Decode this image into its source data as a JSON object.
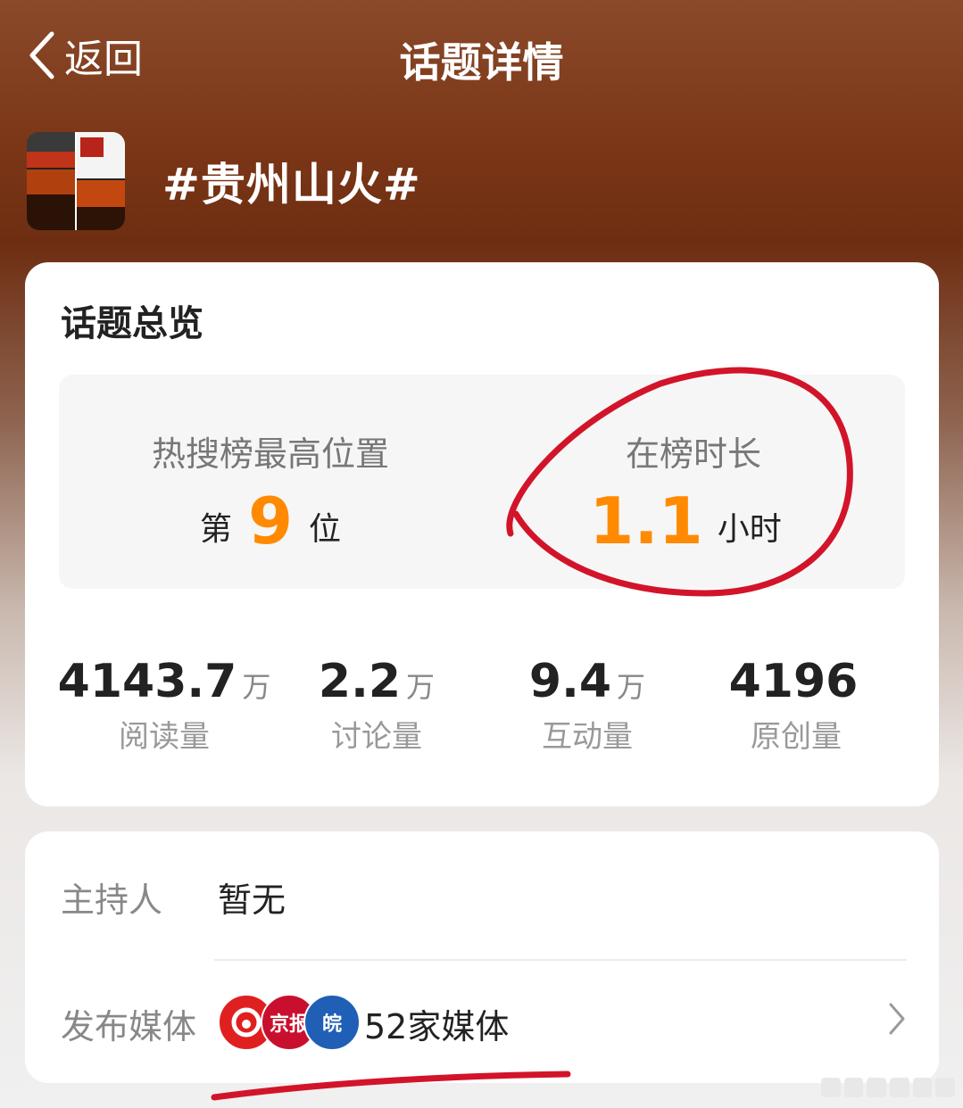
{
  "nav": {
    "back_label": "返回",
    "title": "话题详情"
  },
  "topic": {
    "title": "#贵州山火#"
  },
  "overview": {
    "title": "话题总览",
    "highest_rank": {
      "label": "热搜榜最高位置",
      "prefix": "第",
      "value": "9",
      "suffix": "位"
    },
    "duration": {
      "label": "在榜时长",
      "value": "1.1",
      "unit": "小时"
    },
    "stats": [
      {
        "value": "4143.7",
        "unit": "万",
        "label": "阅读量"
      },
      {
        "value": "2.2",
        "unit": "万",
        "label": "讨论量"
      },
      {
        "value": "9.4",
        "unit": "万",
        "label": "互动量"
      },
      {
        "value": "4196",
        "unit": "",
        "label": "原创量"
      }
    ]
  },
  "info": {
    "host_label": "主持人",
    "host_value": "暂无",
    "media_label": "发布媒体",
    "media_value": "52家媒体",
    "media_logos": [
      {
        "color": "#e02020",
        "text": ""
      },
      {
        "color": "#c8102e",
        "text": "京报"
      },
      {
        "color": "#1f5fb5",
        "text": "皖"
      }
    ]
  },
  "colors": {
    "accent": "#ff8a00",
    "annotation": "#d2142a"
  },
  "icons": {
    "back": "chevron-left-icon",
    "row_arrow": "chevron-right-icon"
  }
}
